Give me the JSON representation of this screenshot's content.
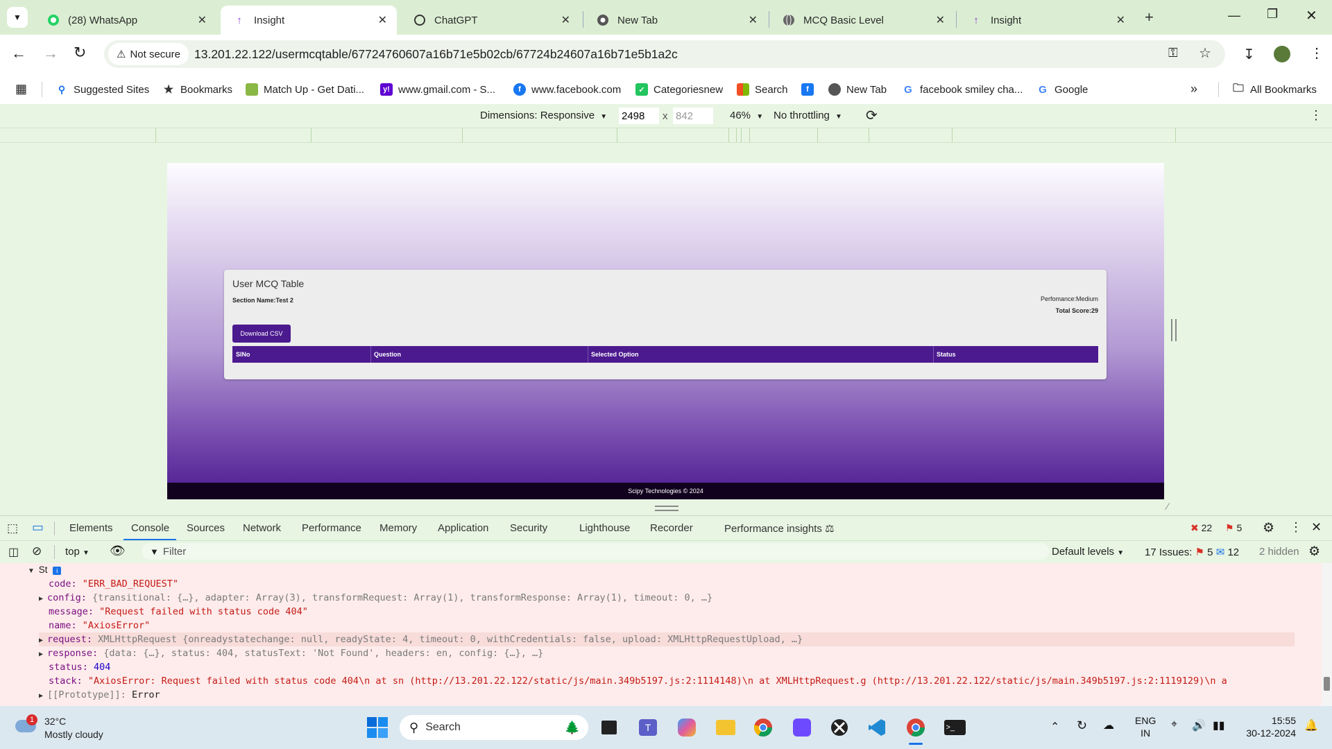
{
  "browser": {
    "tabs": [
      {
        "label": "(28) WhatsApp",
        "icon": "whatsapp-icon"
      },
      {
        "label": "Insight",
        "icon": "insight-icon",
        "active": true
      },
      {
        "label": "ChatGPT",
        "icon": "chatgpt-icon"
      },
      {
        "label": "New Tab",
        "icon": "chrome-icon"
      },
      {
        "label": "MCQ Basic Level",
        "icon": "globe-icon"
      },
      {
        "label": "Insight",
        "icon": "insight-icon"
      }
    ],
    "security_label": "Not secure",
    "url": "13.201.22.122/usermcqtable/67724760607a16b71e5b02cb/67724b24607a16b71e5b1a2c",
    "bookmarks": [
      "Suggested Sites",
      "Bookmarks",
      "Match Up - Get Dati...",
      "www.gmail.com - S...",
      "www.facebook.com",
      "Categoriesnew",
      "Search",
      "New Tab",
      "facebook smiley cha...",
      "Google"
    ],
    "all_bookmarks": "All Bookmarks"
  },
  "device_toolbar": {
    "dimensions": "Dimensions: Responsive",
    "width": "2498",
    "height": "842",
    "times": "x",
    "zoom": "46%",
    "throttling": "No throttling"
  },
  "page": {
    "card_title": "User MCQ Table",
    "section_name": "Section Name:Test 2",
    "performance": "Perfomance:Medium",
    "total_score": "Total Score:29",
    "download_button": "Download CSV",
    "table_headers": [
      "SlNo",
      "Question",
      "Selected Option",
      "Status"
    ],
    "footer": "Scipy Technologies © 2024",
    "accent_color": "#4b1a8f"
  },
  "devtools": {
    "tabs": [
      "Elements",
      "Console",
      "Sources",
      "Network",
      "Performance",
      "Memory",
      "Application",
      "Security",
      "Lighthouse",
      "Recorder",
      "Performance insights"
    ],
    "active_tab": "Console",
    "error_count": "22",
    "warning_count": "5",
    "context": "top",
    "filter_placeholder": "Filter",
    "levels": "Default levels",
    "issues_label": "17 Issues:",
    "issues_errors": "5",
    "issues_info": "12",
    "hidden": "2 hidden",
    "console_lines": {
      "header": "St",
      "code_key": "code:",
      "code_val": "\"ERR_BAD_REQUEST\"",
      "config_key": "config:",
      "config_val": "{transitional: {…}, adapter: Array(3), transformRequest: Array(1), transformResponse: Array(1), timeout: 0, …}",
      "message_key": "message:",
      "message_val": "\"Request failed with status code 404\"",
      "name_key": "name:",
      "name_val": "\"AxiosError\"",
      "request_key": "request:",
      "request_val": "XMLHttpRequest {onreadystatechange: null, readyState: 4, timeout: 0, withCredentials: false, upload: XMLHttpRequestUpload, …}",
      "response_key": "response:",
      "response_val": "{data: {…}, status: 404, statusText: 'Not Found', headers: en, config: {…}, …}",
      "status_key": "status:",
      "status_val": "404",
      "stack_key": "stack:",
      "stack_val": "\"AxiosError: Request failed with status code 404\\n    at sn (http://13.201.22.122/static/js/main.349b5197.js:2:1114148)\\n    at XMLHttpRequest.g (http://13.201.22.122/static/js/main.349b5197.js:2:1119129)\\n    a",
      "proto_key": "[[Prototype]]:",
      "proto_val": "Error"
    }
  },
  "taskbar": {
    "weather_temp": "32°C",
    "weather_desc": "Mostly cloudy",
    "weather_badge": "1",
    "search": "Search",
    "lang_top": "ENG",
    "lang_bottom": "IN",
    "time": "15:55",
    "date": "30-12-2024"
  }
}
